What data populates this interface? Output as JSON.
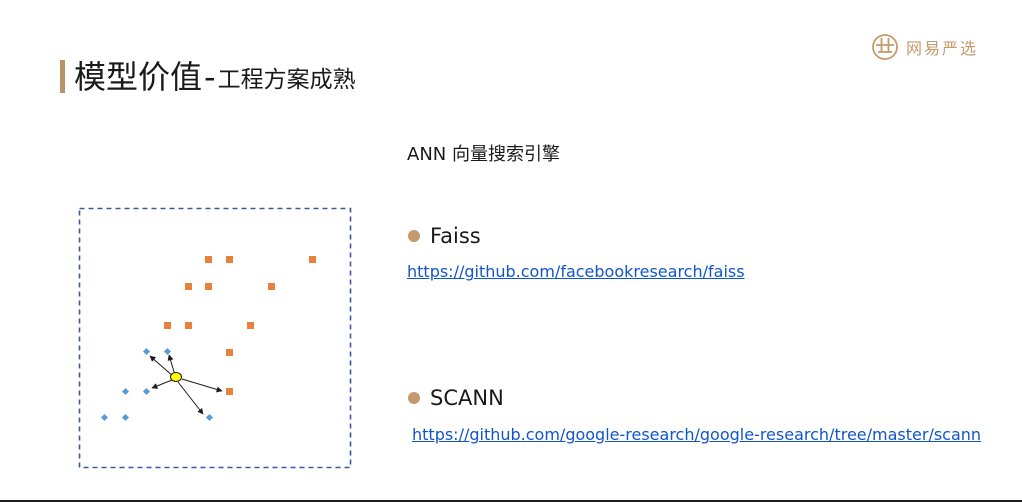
{
  "title": {
    "main": "模型价值",
    "sep": "-",
    "sub": "工程方案成熟"
  },
  "logo": {
    "text": "网易严选",
    "icon": "yanxuan-logo-icon"
  },
  "ann_heading": "ANN 向量搜索引擎",
  "items": [
    {
      "name": "Faiss",
      "link": "https://github.com/facebookresearch/faiss"
    },
    {
      "name": "SCANN",
      "link": "https://github.com/google-research/google-research/tree/master/scann"
    }
  ],
  "colors": {
    "accent": "#c49a6c",
    "title_bar": "#b89566",
    "link": "#1155cc",
    "orange_point": "#e8813a",
    "blue_point": "#5b9bd5",
    "query_point": "#ffff00",
    "frame": "#3b5998"
  }
}
